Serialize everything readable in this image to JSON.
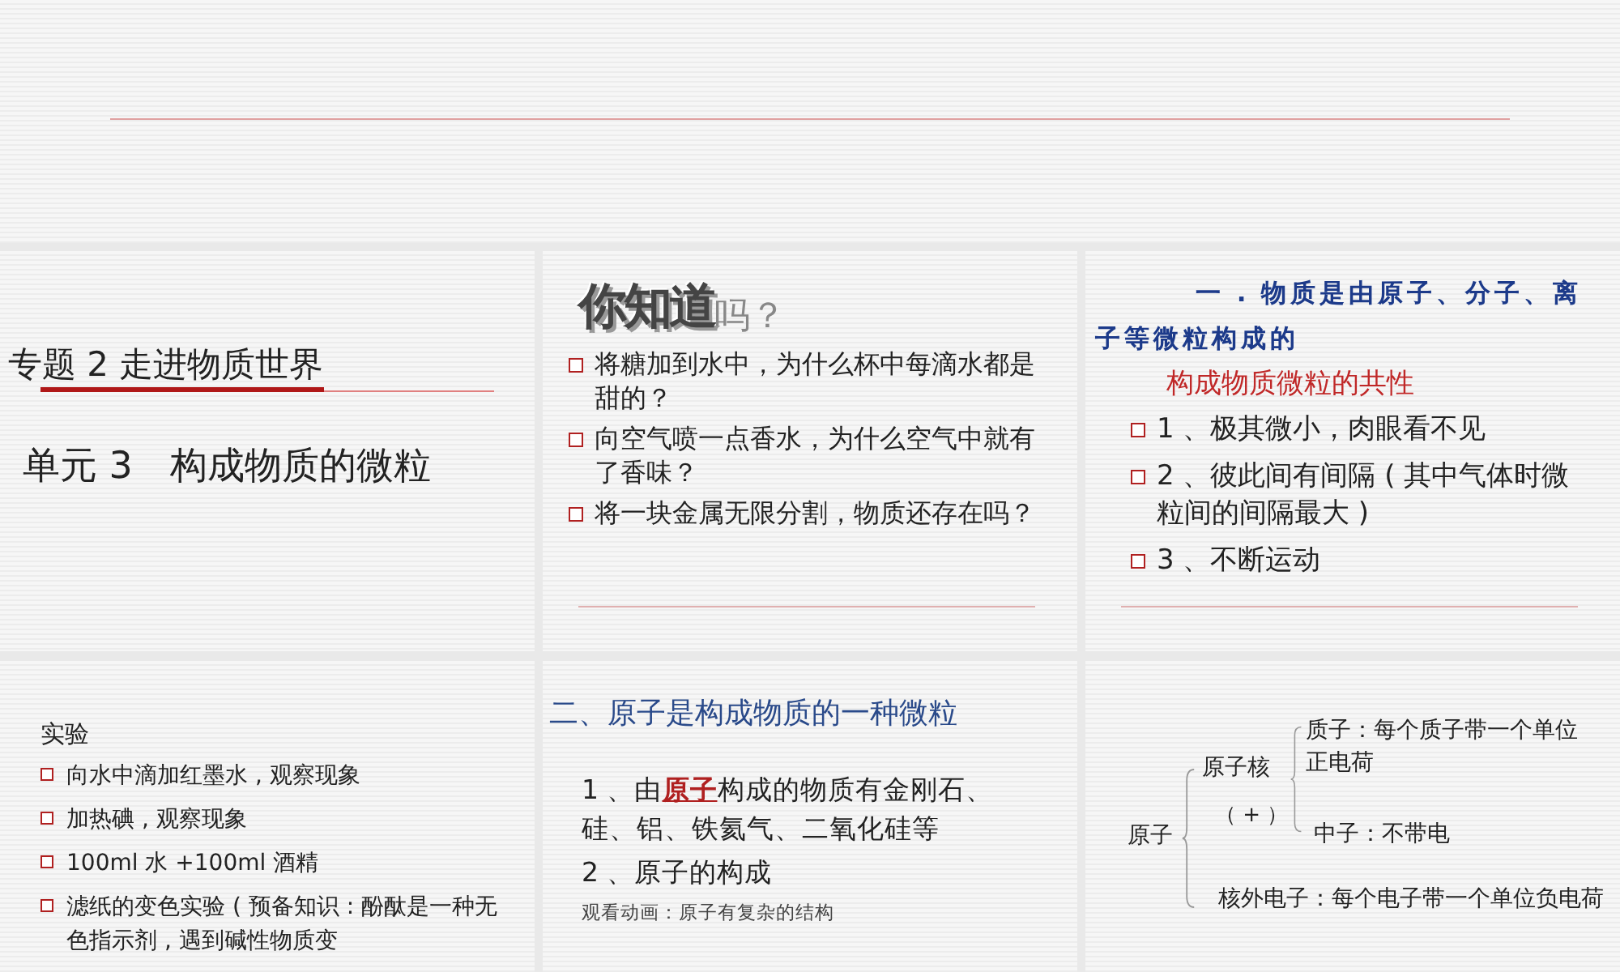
{
  "slides": [
    {
      "kind": "title",
      "title": "专题 2  走进物质世界",
      "subtitle": "单元 3　构成物质的微粒"
    },
    {
      "kind": "question",
      "wordart": "你知道",
      "wordart_tail": "吗？",
      "bullets": [
        "将糖加到水中，为什么杯中每滴水都是甜的？",
        "向空气喷一点香水，为什么空气中就有了香味？",
        "将一块金属无限分割，物质还存在吗？"
      ]
    },
    {
      "kind": "properties",
      "heading": "一 . 物质是由原子、分子、离子等微粒构成的",
      "subheading": "构成物质微粒的共性",
      "bullets": [
        "1 、极其微小，肉眼看不见",
        "2 、彼此间有间隔 ( 其中气体时微粒间的间隔最大 )",
        "3 、不断运动"
      ]
    },
    {
      "kind": "experiment",
      "heading": "实验",
      "bullets": [
        "向水中滴加红墨水 , 观察现象",
        "加热碘 , 观察现象",
        "100ml 水 +100ml 酒精",
        "滤纸的变色实验 ( 预备知识 : 酚酞是一种无色指示剂 , 遇到碱性物质变"
      ]
    },
    {
      "kind": "section",
      "heading": "二、原子是构成物质的一种微粒",
      "item_prefix": "1 、由",
      "item_link": "原子",
      "item_rest": "构成的物质有金刚石、硅、铝、铁氦气、二氧化硅等",
      "item2": "2 、原子的构成",
      "note": "观看动画：原子有复杂的结构"
    },
    {
      "kind": "diagram",
      "root": "原子",
      "nucleus": "原子核",
      "charge": "（ + ）",
      "proton": "质子：每个质子带一个单位正电荷",
      "neutron": "中子：不带电",
      "electron": "核外电子：每个电子带一个单位负电荷"
    }
  ]
}
